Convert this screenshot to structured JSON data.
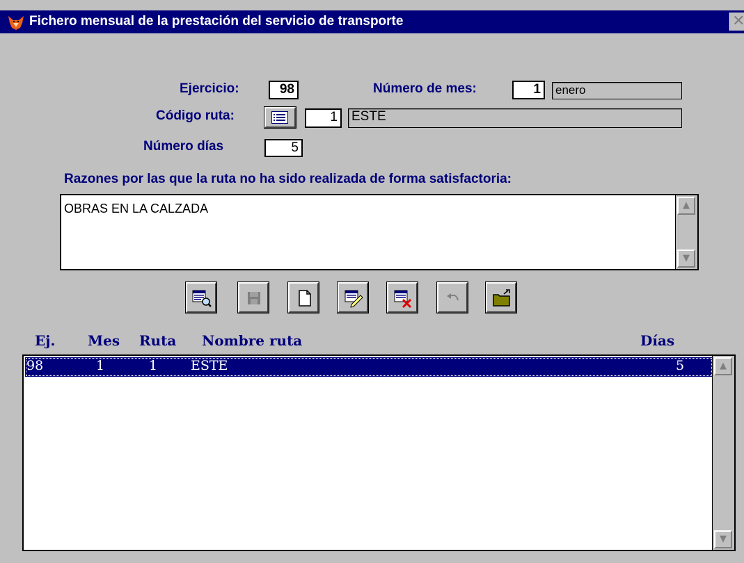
{
  "window": {
    "title": "Fichero mensual de la prestación del servicio de transporte",
    "close_glyph": "✕"
  },
  "form": {
    "ejercicio_label": "Ejercicio:",
    "ejercicio_value": "98",
    "mes_label": "Número de mes:",
    "mes_value": "1",
    "mes_name": "enero",
    "ruta_label": "Código ruta:",
    "ruta_code": "1",
    "ruta_name": "ESTE",
    "dias_label": "Número días",
    "dias_value": "5",
    "razones_label": "Razones por las que la ruta no ha sido realizada de forma satisfactoria:",
    "razones_text": "OBRAS EN LA CALZADA"
  },
  "toolbar": {
    "buttons": [
      {
        "icon": "search-list-icon",
        "enabled": true
      },
      {
        "icon": "save-icon",
        "enabled": false
      },
      {
        "icon": "new-document-icon",
        "enabled": true
      },
      {
        "icon": "edit-record-icon",
        "enabled": true
      },
      {
        "icon": "delete-record-icon",
        "enabled": true
      },
      {
        "icon": "undo-icon",
        "enabled": false
      },
      {
        "icon": "exit-folder-icon",
        "enabled": true
      }
    ]
  },
  "grid": {
    "headers": {
      "ej": "Ej.",
      "mes": "Mes",
      "ruta": "Ruta",
      "nombre": "Nombre ruta",
      "dias": "Días"
    },
    "rows": [
      {
        "ej": "98",
        "mes": "1",
        "ruta": "1",
        "nombre": "ESTE",
        "dias": "5",
        "selected": true
      }
    ]
  },
  "colors": {
    "title_bar": "#00007b",
    "label_text": "#00007b",
    "background": "#c0c0c0",
    "selection": "#00007b"
  }
}
